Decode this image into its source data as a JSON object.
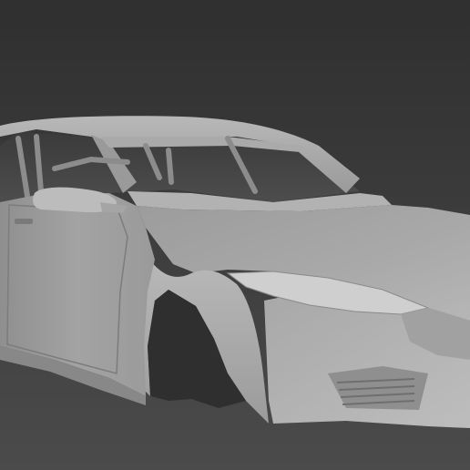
{
  "viewport": {
    "background_top": "#2f2f2f",
    "background_bottom": "#4a4a4a",
    "model_color": "#a6a6a6",
    "model_shadow": "#6e6e6e",
    "model_highlight": "#c4c4c4"
  }
}
